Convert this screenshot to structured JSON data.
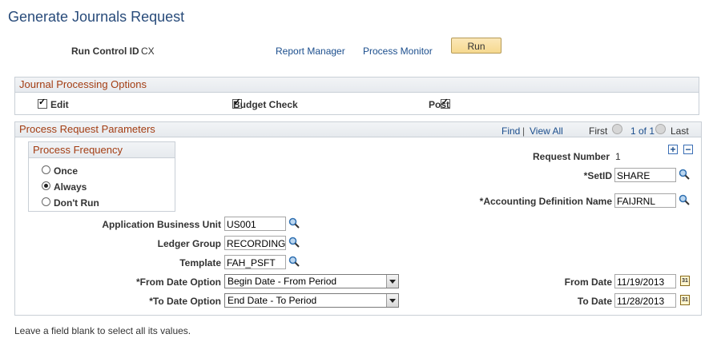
{
  "page": {
    "title": "Generate Journals Request",
    "footer_note": "Leave a field blank to select all its values."
  },
  "header": {
    "run_control_label": "Run Control ID",
    "run_control_value": "CX",
    "report_manager": "Report Manager",
    "process_monitor": "Process Monitor",
    "run_label": "Run"
  },
  "journal_options": {
    "heading": "Journal Processing Options",
    "edit_label": "Edit",
    "budget_label": "Budget Check",
    "post_label": "Post",
    "edit_checked": true,
    "budget_checked": true,
    "post_checked": true
  },
  "params": {
    "heading": "Process Request Parameters",
    "find": "Find",
    "sep": "|",
    "view_all": "View All",
    "first": "First",
    "page_info": "1 of 1",
    "last": "Last",
    "frequency_heading": "Process Frequency",
    "freq_once": "Once",
    "freq_always": "Always",
    "freq_dont": "Don't Run",
    "freq_selected": "Always",
    "request_number_label": "Request Number",
    "request_number_value": "1",
    "setid_label": "*SetID",
    "setid_value": "SHARE",
    "acct_def_label": "*Accounting Definition Name",
    "acct_def_value": "FAIJRNL",
    "abu_label": "Application Business Unit",
    "abu_value": "US001",
    "ledger_group_label": "Ledger Group",
    "ledger_group_value": "RECORDING",
    "template_label": "Template",
    "template_value": "FAH_PSFT",
    "from_date_option_label": "*From Date Option",
    "from_date_option_value": "Begin Date - From Period",
    "to_date_option_label": "*To Date Option",
    "to_date_option_value": "End Date - To Period",
    "from_date_label": "From Date",
    "from_date_value": "11/19/2013",
    "to_date_label": "To Date",
    "to_date_value": "11/28/2013",
    "add_symbol": "+",
    "remove_symbol": "−",
    "cal_glyph": "31"
  },
  "colors": {
    "title": "#284b7a",
    "section_heading": "#a33d13",
    "link": "#1b4e8d",
    "run_button": "#f6d98f"
  }
}
